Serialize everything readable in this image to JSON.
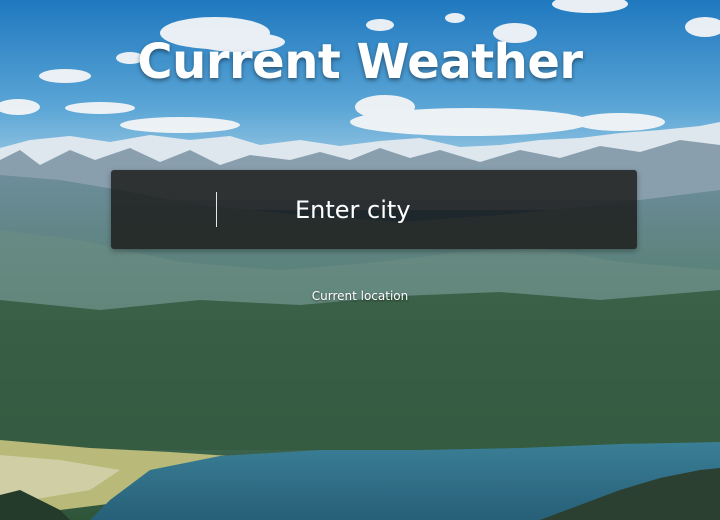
{
  "header": {
    "title": "Current Weather"
  },
  "search": {
    "placeholder": "Enter city"
  },
  "location_link": {
    "label": "Current location"
  },
  "background": {
    "description_icon": "mountain-landscape-image",
    "sky_color": "#2f86c4",
    "mountain_color": "#5d7f8e",
    "forest_color": "#3b5e44",
    "lake_color": "#2e6e86"
  }
}
